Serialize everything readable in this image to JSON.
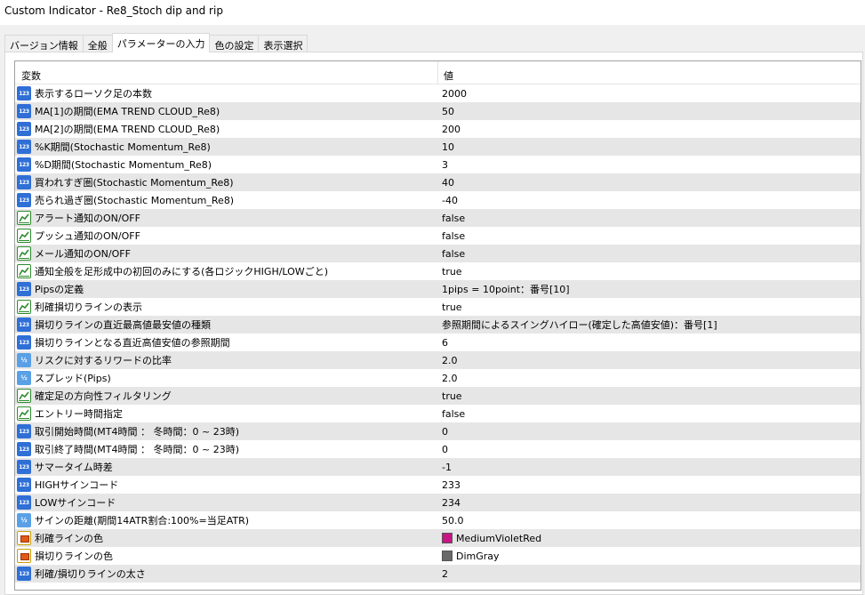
{
  "window": {
    "title": "Custom Indicator - Re8_Stoch dip and rip"
  },
  "tabs": [
    {
      "label": "バージョン情報"
    },
    {
      "label": "全般"
    },
    {
      "label": "パラメーターの入力"
    },
    {
      "label": "色の設定"
    },
    {
      "label": "表示選択"
    }
  ],
  "active_tab": "パラメーターの入力",
  "grid": {
    "col_variable": "変数",
    "col_value": "値",
    "rows": [
      {
        "icon": "integer-icon",
        "name": "表示するローソク足の本数",
        "value": "2000"
      },
      {
        "icon": "integer-icon",
        "name": "MA[1]の期間(EMA TREND CLOUD_Re8)",
        "value": "50"
      },
      {
        "icon": "integer-icon",
        "name": "MA[2]の期間(EMA TREND CLOUD_Re8)",
        "value": "200"
      },
      {
        "icon": "integer-icon",
        "name": "%K期間(Stochastic Momentum_Re8)",
        "value": "10"
      },
      {
        "icon": "integer-icon",
        "name": "%D期間(Stochastic Momentum_Re8)",
        "value": "3"
      },
      {
        "icon": "integer-icon",
        "name": "買われすぎ圏(Stochastic Momentum_Re8)",
        "value": "40"
      },
      {
        "icon": "integer-icon",
        "name": "売られ過ぎ圏(Stochastic Momentum_Re8)",
        "value": "-40"
      },
      {
        "icon": "boolean-icon",
        "name": "アラート通知のON/OFF",
        "value": "false"
      },
      {
        "icon": "boolean-icon",
        "name": "プッシュ通知のON/OFF",
        "value": "false"
      },
      {
        "icon": "boolean-icon",
        "name": "メール通知のON/OFF",
        "value": "false"
      },
      {
        "icon": "boolean-icon",
        "name": "通知全般を足形成中の初回のみにする(各ロジックHIGH/LOWごと)",
        "value": "true"
      },
      {
        "icon": "integer-icon",
        "name": "Pipsの定義",
        "value": "1pips = 10point：番号[10]"
      },
      {
        "icon": "boolean-icon",
        "name": "利確損切りラインの表示",
        "value": "true"
      },
      {
        "icon": "integer-icon",
        "name": "損切りラインの直近最高値最安値の種類",
        "value": "参照期間によるスイングハイロー(確定した高値安値)：番号[1]"
      },
      {
        "icon": "integer-icon",
        "name": "損切りラインとなる直近高値安値の参照期間",
        "value": "6"
      },
      {
        "icon": "double-icon",
        "name": "リスクに対するリワードの比率",
        "value": "2.0"
      },
      {
        "icon": "double-icon",
        "name": "スプレッド(Pips)",
        "value": "2.0"
      },
      {
        "icon": "boolean-icon",
        "name": "確定足の方向性フィルタリング",
        "value": "true"
      },
      {
        "icon": "boolean-icon",
        "name": "エントリー時間指定",
        "value": "false"
      },
      {
        "icon": "integer-icon",
        "name": "取引開始時間(MT4時間 ： 冬時間：0 ~ 23時)",
        "value": "0"
      },
      {
        "icon": "integer-icon",
        "name": "取引終了時間(MT4時間 ： 冬時間：0 ~ 23時)",
        "value": "0"
      },
      {
        "icon": "integer-icon",
        "name": "サマータイム時差",
        "value": "-1"
      },
      {
        "icon": "integer-icon",
        "name": "HIGHサインコード",
        "value": "233"
      },
      {
        "icon": "integer-icon",
        "name": "LOWサインコード",
        "value": "234"
      },
      {
        "icon": "double-icon",
        "name": "サインの距離(期間14ATR割合:100%=当足ATR)",
        "value": "50.0"
      },
      {
        "icon": "color-icon",
        "name": "利確ラインの色",
        "value": "MediumVioletRed",
        "swatch": "#c71585"
      },
      {
        "icon": "color-icon",
        "name": "損切りラインの色",
        "value": "DimGray",
        "swatch": "#696969"
      },
      {
        "icon": "integer-icon",
        "name": "利確/損切りラインの太さ",
        "value": "2"
      }
    ]
  }
}
